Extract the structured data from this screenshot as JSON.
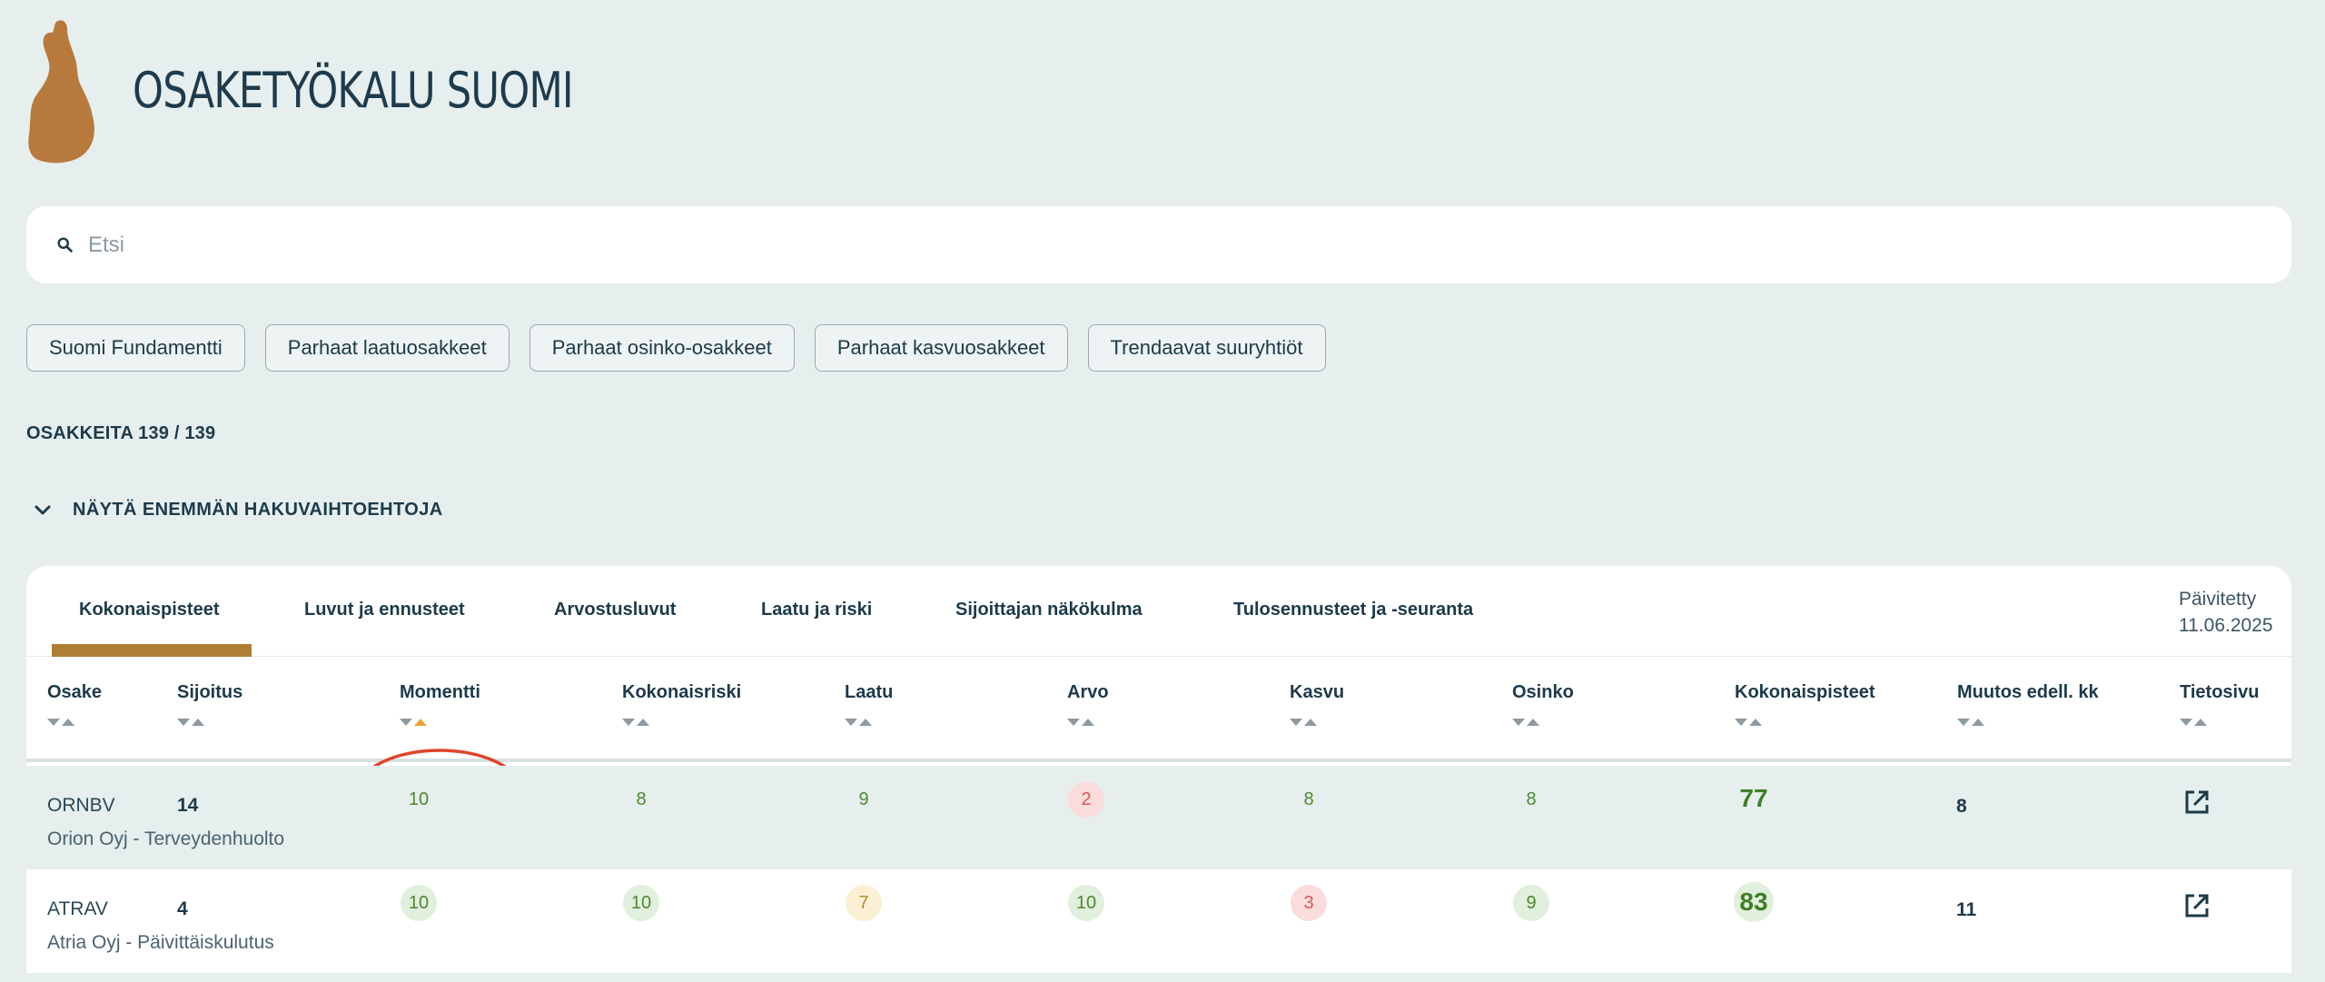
{
  "app": {
    "title": "OSAKETYÖKALU SUOMI",
    "logo_icon": "finland-map-icon",
    "logo_color": "#b87a3c"
  },
  "search": {
    "placeholder": "Etsi",
    "value": ""
  },
  "presets": [
    "Suomi Fundamentti",
    "Parhaat laatuosakkeet",
    "Parhaat osinko-osakkeet",
    "Parhaat kasvuosakkeet",
    "Trendaavat suuryhtiöt"
  ],
  "count_label": "OSAKKEITA 139 / 139",
  "expander_label": "NÄYTÄ ENEMMÄN HAKUVAIHTOEHTOJA",
  "tabs": [
    {
      "label": "Kokonaispisteet",
      "active": true
    },
    {
      "label": "Luvut ja ennusteet"
    },
    {
      "label": "Arvostusluvut"
    },
    {
      "label": "Laatu ja riski"
    },
    {
      "label": "Sijoittajan näkökulma"
    },
    {
      "label": "Tulosennusteet ja -seuranta"
    }
  ],
  "updated": {
    "label": "Päivitetty",
    "date": "11.06.2025"
  },
  "columns": [
    "Osake",
    "Sijoitus",
    "Momentti",
    "Kokonaisriski",
    "Laatu",
    "Arvo",
    "Kasvu",
    "Osinko",
    "Kokonaispisteet",
    "Muutos edell. kk",
    "Tietosivu"
  ],
  "sorted_column": "Momentti",
  "sort_active_color": "#e8a33b",
  "highlight_color": "#e0442a",
  "rows": [
    {
      "ticker": "ORNBV",
      "company": "Orion Oyj - Terveydenhuolto",
      "rank": "14",
      "momentti": "10",
      "kokonaisriski": "8",
      "laatu": "9",
      "arvo": "2",
      "kasvu": "8",
      "osinko": "8",
      "kokonaispisteet": "77",
      "muutos": "8"
    },
    {
      "ticker": "ATRAV",
      "company": "Atria Oyj - Päivittäiskulutus",
      "rank": "4",
      "momentti": "10",
      "kokonaisriski": "10",
      "laatu": "7",
      "arvo": "10",
      "kasvu": "3",
      "osinko": "9",
      "kokonaispisteet": "83",
      "muutos": "11"
    }
  ]
}
